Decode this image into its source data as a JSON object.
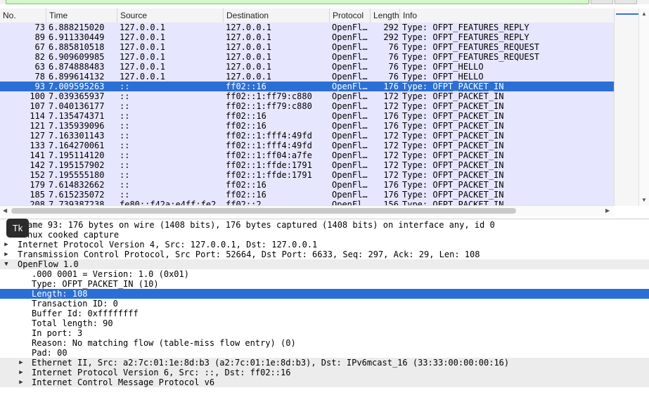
{
  "columns": [
    "No.",
    "Time",
    "Source",
    "Destination",
    "Protocol",
    "Length",
    "Info"
  ],
  "packets": [
    {
      "no": "73",
      "time": "6.888215020",
      "src": "127.0.0.1",
      "dst": "127.0.0.1",
      "proto": "OpenFl…",
      "len": "292",
      "info": "Type: OFPT_FEATURES_REPLY"
    },
    {
      "no": "89",
      "time": "6.911330449",
      "src": "127.0.0.1",
      "dst": "127.0.0.1",
      "proto": "OpenFl…",
      "len": "292",
      "info": "Type: OFPT_FEATURES_REPLY"
    },
    {
      "no": "67",
      "time": "6.885810518",
      "src": "127.0.0.1",
      "dst": "127.0.0.1",
      "proto": "OpenFl…",
      "len": "76",
      "info": "Type: OFPT_FEATURES_REQUEST"
    },
    {
      "no": "82",
      "time": "6.909609985",
      "src": "127.0.0.1",
      "dst": "127.0.0.1",
      "proto": "OpenFl…",
      "len": "76",
      "info": "Type: OFPT_FEATURES_REQUEST"
    },
    {
      "no": "63",
      "time": "6.874888483",
      "src": "127.0.0.1",
      "dst": "127.0.0.1",
      "proto": "OpenFl…",
      "len": "76",
      "info": "Type: OFPT_HELLO"
    },
    {
      "no": "78",
      "time": "6.899614132",
      "src": "127.0.0.1",
      "dst": "127.0.0.1",
      "proto": "OpenFl…",
      "len": "76",
      "info": "Type: OFPT_HELLO"
    },
    {
      "no": "93",
      "time": "7.009595263",
      "src": "::",
      "dst": "ff02::16",
      "proto": "OpenFl…",
      "len": "176",
      "info": "Type: OFPT_PACKET_IN",
      "selected": true
    },
    {
      "no": "100",
      "time": "7.039365937",
      "src": "::",
      "dst": "ff02::1:ff79:c880",
      "proto": "OpenFl…",
      "len": "172",
      "info": "Type: OFPT_PACKET_IN"
    },
    {
      "no": "107",
      "time": "7.040136177",
      "src": "::",
      "dst": "ff02::1:ff79:c880",
      "proto": "OpenFl…",
      "len": "172",
      "info": "Type: OFPT_PACKET_IN"
    },
    {
      "no": "114",
      "time": "7.135474371",
      "src": "::",
      "dst": "ff02::16",
      "proto": "OpenFl…",
      "len": "176",
      "info": "Type: OFPT_PACKET_IN"
    },
    {
      "no": "121",
      "time": "7.135939096",
      "src": "::",
      "dst": "ff02::16",
      "proto": "OpenFl…",
      "len": "176",
      "info": "Type: OFPT_PACKET_IN"
    },
    {
      "no": "127",
      "time": "7.163301143",
      "src": "::",
      "dst": "ff02::1:fff4:49fd",
      "proto": "OpenFl…",
      "len": "172",
      "info": "Type: OFPT_PACKET_IN"
    },
    {
      "no": "133",
      "time": "7.164270061",
      "src": "::",
      "dst": "ff02::1:fff4:49fd",
      "proto": "OpenFl…",
      "len": "172",
      "info": "Type: OFPT_PACKET_IN"
    },
    {
      "no": "141",
      "time": "7.195114120",
      "src": "::",
      "dst": "ff02::1:ff04:a7fe",
      "proto": "OpenFl…",
      "len": "172",
      "info": "Type: OFPT_PACKET_IN"
    },
    {
      "no": "142",
      "time": "7.195157902",
      "src": "::",
      "dst": "ff02::1:ffde:1791",
      "proto": "OpenFl…",
      "len": "172",
      "info": "Type: OFPT_PACKET_IN"
    },
    {
      "no": "152",
      "time": "7.195555180",
      "src": "::",
      "dst": "ff02::1:ffde:1791",
      "proto": "OpenFl…",
      "len": "172",
      "info": "Type: OFPT_PACKET_IN"
    },
    {
      "no": "179",
      "time": "7.614832662",
      "src": "::",
      "dst": "ff02::16",
      "proto": "OpenFl…",
      "len": "176",
      "info": "Type: OFPT_PACKET_IN"
    },
    {
      "no": "185",
      "time": "7.615235072",
      "src": "::",
      "dst": "ff02::16",
      "proto": "OpenFl…",
      "len": "176",
      "info": "Type: OFPT_PACKET_IN"
    },
    {
      "no": "208",
      "time": "7.739387238",
      "src": "fe80::f42a:e4ff:fe2…",
      "dst": "ff02::2",
      "proto": "OpenFl…",
      "len": "156",
      "info": "Type: OFPT_PACKET_IN"
    }
  ],
  "details": [
    {
      "indent": 0,
      "expander": "none",
      "text": "ame 93: 176 bytes on wire (1408 bits), 176 bytes captured (1408 bits) on interface any, id 0"
    },
    {
      "indent": 0,
      "expander": "none",
      "text": "nux cooked capture"
    },
    {
      "indent": 0,
      "expander": "collapsed",
      "text": "Internet Protocol Version 4, Src: 127.0.0.1, Dst: 127.0.0.1"
    },
    {
      "indent": 0,
      "expander": "collapsed",
      "text": "Transmission Control Protocol, Src Port: 52664, Dst Port: 6633, Seq: 297, Ack: 29, Len: 108"
    },
    {
      "indent": 0,
      "expander": "expanded",
      "text": "OpenFlow 1.0",
      "shade": true
    },
    {
      "indent": 1,
      "expander": "none",
      "text": ".000 0001 = Version: 1.0 (0x01)"
    },
    {
      "indent": 1,
      "expander": "none",
      "text": "Type: OFPT_PACKET_IN (10)"
    },
    {
      "indent": 1,
      "expander": "none",
      "text": "Length: 108",
      "highlight": true
    },
    {
      "indent": 1,
      "expander": "none",
      "text": "Transaction ID: 0"
    },
    {
      "indent": 1,
      "expander": "none",
      "text": "Buffer Id: 0xffffffff"
    },
    {
      "indent": 1,
      "expander": "none",
      "text": "Total length: 90"
    },
    {
      "indent": 1,
      "expander": "none",
      "text": "In port: 3"
    },
    {
      "indent": 1,
      "expander": "none",
      "text": "Reason: No matching flow (table-miss flow entry) (0)"
    },
    {
      "indent": 1,
      "expander": "none",
      "text": "Pad: 00"
    },
    {
      "indent": 1,
      "expander": "collapsed",
      "text": "Ethernet II, Src: a2:7c:01:1e:8d:b3 (a2:7c:01:1e:8d:b3), Dst: IPv6mcast_16 (33:33:00:00:00:16)",
      "shade": true
    },
    {
      "indent": 1,
      "expander": "collapsed",
      "text": "Internet Protocol Version 6, Src: ::, Dst: ff02::16",
      "shade": true
    },
    {
      "indent": 1,
      "expander": "collapsed",
      "text": "Internet Control Message Protocol v6",
      "shade": true
    }
  ],
  "tooltip_badge": "Tk",
  "icons": {
    "expander_collapsed": "triangle-right-icon",
    "expander_expanded": "triangle-down-icon"
  },
  "colors": {
    "row_bg": "#e7e6ff",
    "selection": "#2a6fd6",
    "filter_ok": "#d4f7c9"
  }
}
